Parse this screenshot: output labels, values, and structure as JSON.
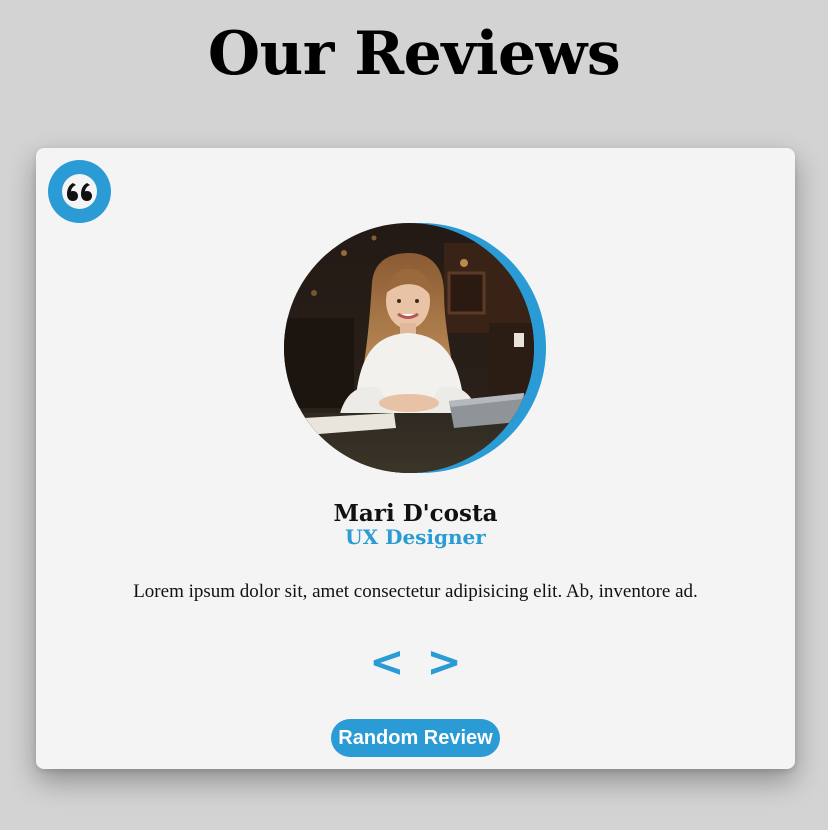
{
  "header": {
    "title": "Our Reviews"
  },
  "review": {
    "quote_icon": "quote-icon",
    "name": "Mari D'costa",
    "role": "UX Designer",
    "text": "Lorem ipsum dolor sit, amet consectetur adipisicing elit. Ab, inventore ad."
  },
  "controls": {
    "prev_label": "<",
    "next_label": ">",
    "random_label": "Random Review"
  },
  "colors": {
    "accent": "#2a9bd5",
    "page_bg": "#d3d3d3",
    "card_bg": "#f4f4f4"
  }
}
